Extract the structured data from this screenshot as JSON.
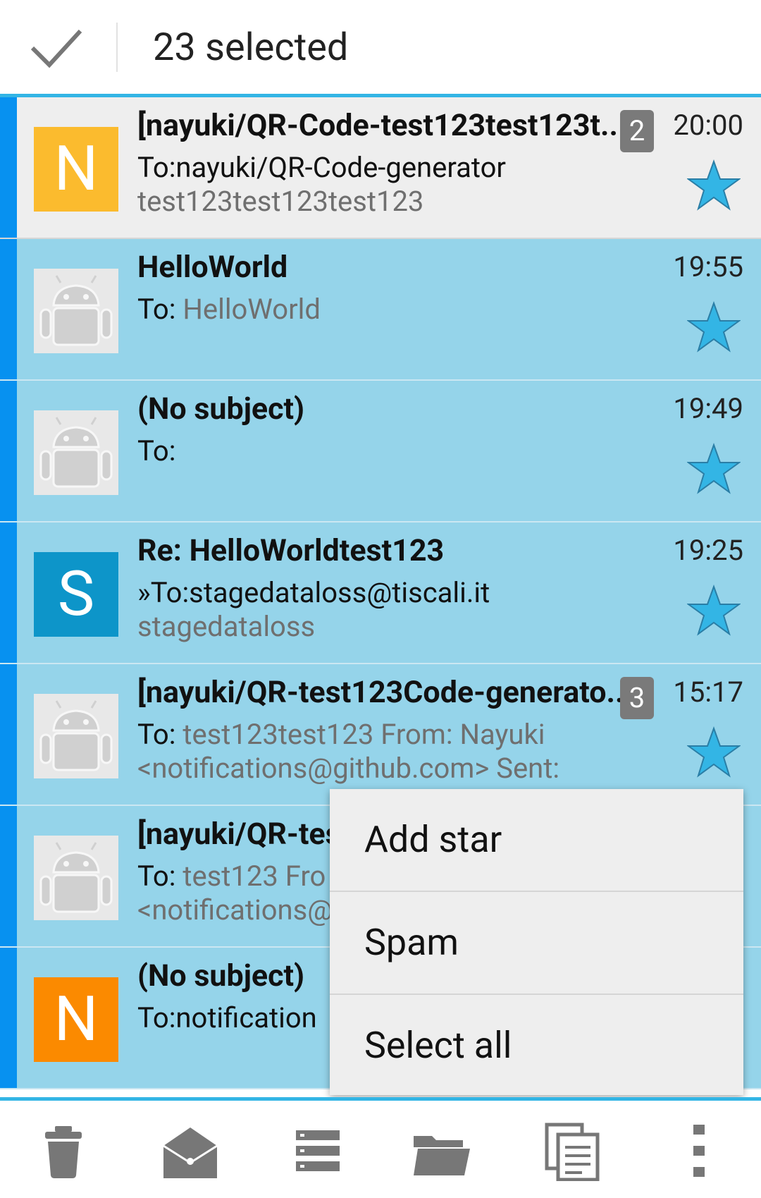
{
  "header": {
    "selected_text": "23 selected"
  },
  "colors": {
    "accent": "#33b5e5",
    "selected_row": "#95d4ea",
    "selection_bar": "#0791f0",
    "avatar_yellow": "#fbbb2e",
    "avatar_blue": "#0d95c9",
    "avatar_orange": "#fb8a00",
    "star": "#33b5e5"
  },
  "messages": [
    {
      "avatar_letter": "N",
      "avatar_type": "letter",
      "avatar_color": "#fbbb2e",
      "subject": "[nayuki/QR-Code-test123test123t..",
      "badge": "2",
      "time": "20:00",
      "to_label": "To:nayuki/QR-Code-generator",
      "to_value": "",
      "preview": "test123test123test123"
    },
    {
      "avatar_type": "android",
      "subject": "HelloWorld",
      "badge": "",
      "time": "19:55",
      "to_label": "To: ",
      "to_value": "HelloWorld",
      "preview": ""
    },
    {
      "avatar_type": "android",
      "subject": "(No subject)",
      "badge": "",
      "time": "19:49",
      "to_label": "To:",
      "to_value": "",
      "preview": ""
    },
    {
      "avatar_letter": "S",
      "avatar_type": "letter",
      "avatar_color": "#0d95c9",
      "subject": "Re: HelloWorldtest123",
      "badge": "",
      "time": "19:25",
      "to_label": "»To:stagedataloss@tiscali.it",
      "to_value": "",
      "preview": "stagedataloss"
    },
    {
      "avatar_type": "android",
      "subject": "[nayuki/QR-test123Code-generato..",
      "badge": "3",
      "time": "15:17",
      "to_label": "To: ",
      "to_value": "test123test123 From: Nayuki",
      "preview": "<notifications@github.com> Sent:"
    },
    {
      "avatar_type": "android",
      "subject": "[nayuki/QR-tes",
      "badge": "",
      "time": "",
      "to_label": "To: ",
      "to_value": "test123 Fro",
      "preview": "<notifications@"
    },
    {
      "avatar_letter": "N",
      "avatar_type": "letter",
      "avatar_color": "#fb8a00",
      "subject": "(No subject)",
      "badge": "",
      "time": "",
      "to_label": "To:notification",
      "to_value": "",
      "preview": ""
    }
  ],
  "menu": {
    "items": [
      "Add star",
      "Spam",
      "Select all"
    ]
  },
  "bottom_bar": {
    "icons": [
      "trash-icon",
      "mark-read-icon",
      "list-icon",
      "folder-icon",
      "copy-icon",
      "overflow-icon"
    ]
  }
}
